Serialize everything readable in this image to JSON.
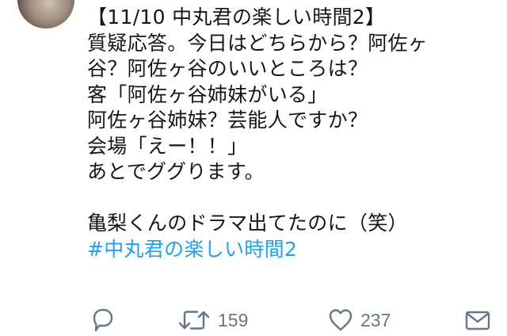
{
  "tweet": {
    "lines": [
      "【11/10 中丸君の楽しい時間2】",
      "質疑応答。今日はどちらから？阿佐ヶ",
      "谷？阿佐ヶ谷のいいところは？",
      "客「阿佐ヶ谷姉妹がいる」",
      "阿佐ヶ谷姉妹？芸能人ですか？",
      "会場「えー！！」",
      "あとでググります。",
      "",
      "亀梨くんのドラマ出てたのに（笑）"
    ],
    "hashtag": "#中丸君の楽しい時間2"
  },
  "actions": {
    "retweet_count": "159",
    "like_count": "237"
  },
  "icons": {
    "reply": "reply-icon",
    "retweet": "retweet-icon",
    "like": "heart-icon",
    "dm": "envelope-icon"
  },
  "colors": {
    "text": "#14171a",
    "hashtag": "#1da1f2",
    "icon": "#657786"
  }
}
